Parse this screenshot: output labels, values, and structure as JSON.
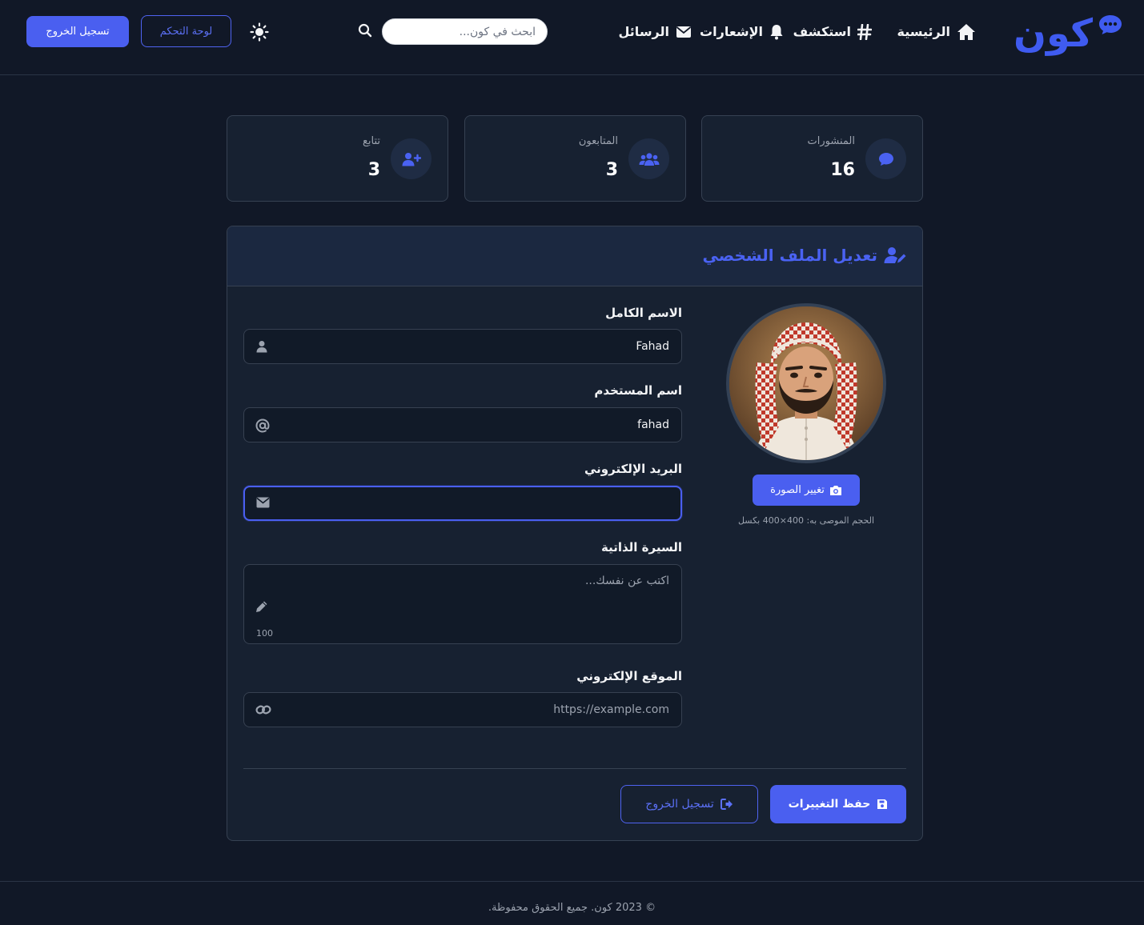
{
  "brand": {
    "name": "كون",
    "icon": "chat-dots-icon",
    "color": "#3f5bf0"
  },
  "nav": {
    "home": {
      "label": "الرئيسية",
      "icon": "home-icon"
    },
    "explore": {
      "label": "استكشف",
      "icon": "hashtag-icon"
    },
    "notifications": {
      "label": "الإشعارات",
      "icon": "bell-icon"
    },
    "messages": {
      "label": "الرسائل",
      "icon": "envelope-icon"
    }
  },
  "search": {
    "placeholder": "ابحث في كون...",
    "value": ""
  },
  "header_actions": {
    "dashboard": "لوحة التحكم",
    "logout": "تسجيل الخروج",
    "theme_icon": "sun-icon"
  },
  "stats": {
    "posts": {
      "label": "المنشورات",
      "value": "16",
      "icon": "comment-icon"
    },
    "followers": {
      "label": "المتابعون",
      "value": "3",
      "icon": "users-icon"
    },
    "following": {
      "label": "تتابع",
      "value": "3",
      "icon": "user-plus-icon"
    }
  },
  "profile": {
    "title": "تعديل الملف الشخصي",
    "title_icon": "user-edit-icon",
    "change_photo": "تغيير الصورة",
    "photo_hint": "الحجم الموصى به: 400×400 بكسل",
    "fields": {
      "fullname": {
        "label": "الاسم الكامل",
        "value": "Fahad",
        "icon": "user-icon"
      },
      "username": {
        "label": "اسم المستخدم",
        "value": "fahad",
        "icon": "at-icon"
      },
      "email": {
        "label": "البريد الإلكتروني",
        "value": "",
        "icon": "envelope-icon"
      },
      "bio": {
        "label": "السيرة الذاتية",
        "placeholder": "اكتب عن نفسك...",
        "value": "",
        "counter": "100",
        "icon": "pencil-icon"
      },
      "website": {
        "label": "الموقع الإلكتروني",
        "placeholder": "https://example.com",
        "value": "",
        "icon": "link-icon"
      }
    },
    "save": "حفظ التغييرات",
    "logout": "تسجيل الخروج"
  },
  "footer": {
    "text": "© 2023 كون. جميع الحقوق محفوظة."
  },
  "colors": {
    "accent": "#4a5ff0",
    "background": "#111827",
    "card": "#172131"
  }
}
